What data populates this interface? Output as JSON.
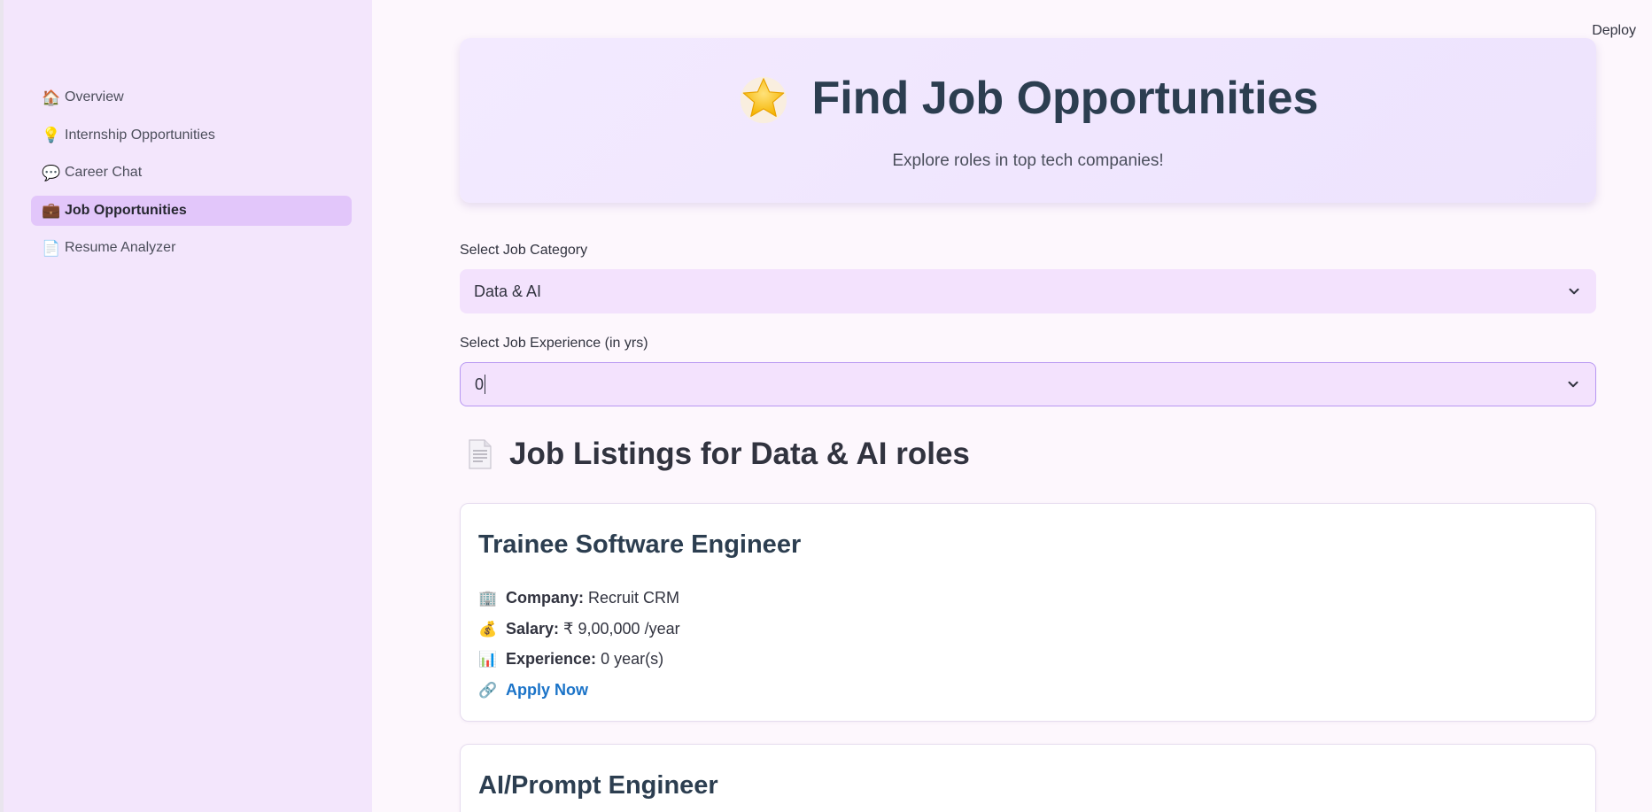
{
  "header": {
    "deploy_label": "Deploy"
  },
  "sidebar": {
    "items": [
      {
        "icon": "🏠",
        "label": "Overview",
        "active": false
      },
      {
        "icon": "💡",
        "label": "Internship Opportunities",
        "active": false
      },
      {
        "icon": "💬",
        "label": "Career Chat",
        "active": false
      },
      {
        "icon": "💼",
        "label": "Job Opportunities",
        "active": true
      },
      {
        "icon": "📄",
        "label": "Resume Analyzer",
        "active": false
      }
    ]
  },
  "hero": {
    "icon": "star-icon",
    "title": "Find Job Opportunities",
    "subtitle": "Explore roles in top tech companies!"
  },
  "filters": {
    "category_label": "Select Job Category",
    "category_value": "Data & AI",
    "experience_label": "Select Job Experience (in yrs)",
    "experience_value": "0"
  },
  "listings": {
    "heading": "Job Listings for Data & AI roles",
    "company_label": "Company:",
    "salary_label": "Salary:",
    "experience_label": "Experience:",
    "apply_label": "Apply Now",
    "jobs": [
      {
        "title": "Trainee Software Engineer",
        "company": "Recruit CRM",
        "salary": "₹ 9,00,000 /year",
        "experience": "0 year(s)"
      },
      {
        "title": "AI/Prompt Engineer"
      }
    ]
  },
  "colors": {
    "sidebar_bg": "#f3e6fc",
    "active_nav_bg": "#e2c6fa",
    "select_bg": "#f3e2fd",
    "link": "#1a73c8",
    "title": "#2c3e50"
  }
}
